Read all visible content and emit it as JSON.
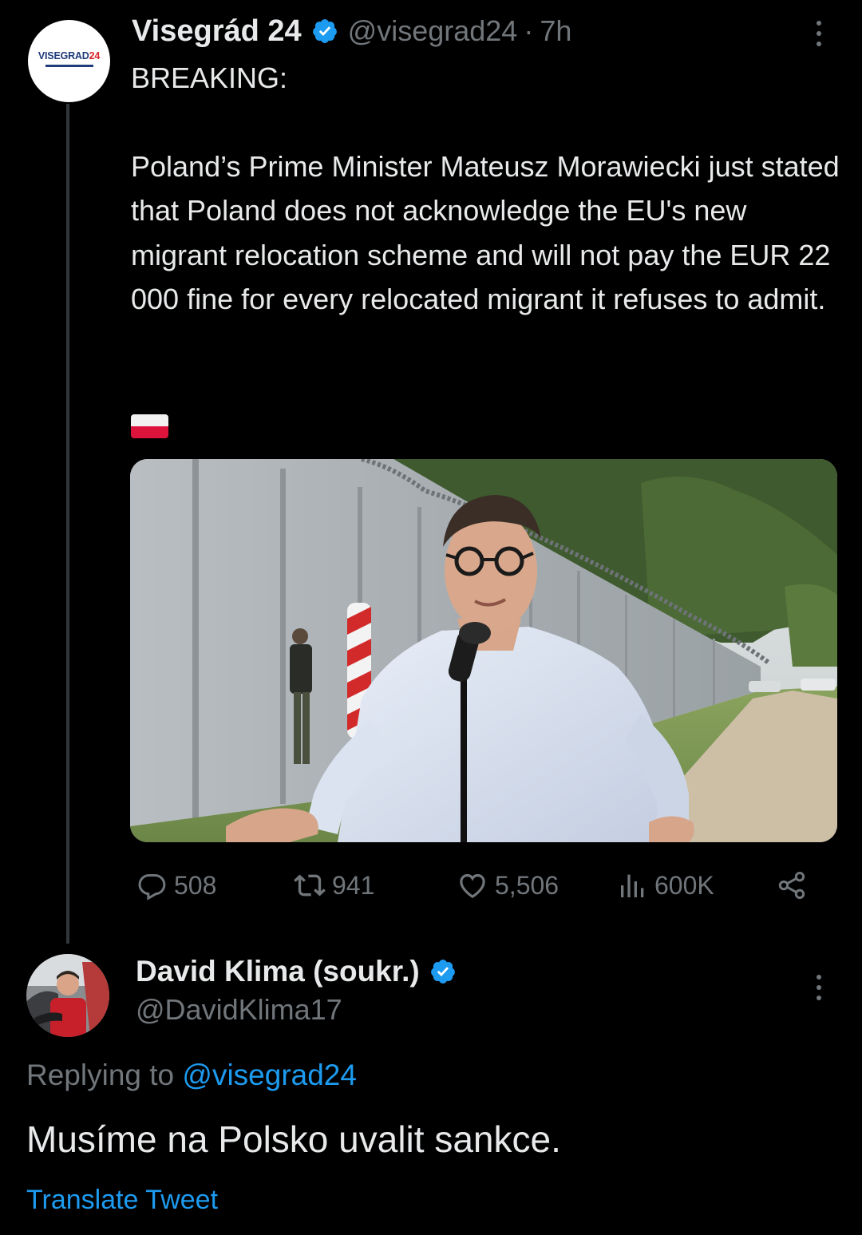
{
  "tweet": {
    "author": {
      "display_name": "Visegrád 24",
      "handle": "@visegrad24",
      "time_ago": "7h",
      "verified": true,
      "avatar_logo_main": "VISEGRAD",
      "avatar_logo_accent": "24"
    },
    "text_headline": "BREAKING:",
    "text_body": "Poland’s Prime Minister Mateusz Morawiecki just stated that Poland does not acknowledge the EU's new migrant relocation scheme and will not pay the EUR 22 000 fine for every relocated migrant it refuses to admit.",
    "flag_emoji_icon": "poland-flag-icon",
    "media_icon": "photo-of-speaker-at-border-fence",
    "actions": {
      "replies": "508",
      "retweets": "941",
      "likes": "5,506",
      "views": "600K"
    }
  },
  "reply": {
    "author": {
      "display_name": "David Klima (soukr.)",
      "handle": "@DavidKlima17",
      "verified": true
    },
    "replying_to_label": "Replying to",
    "replying_to_handle": "@visegrad24",
    "text": "Musíme na Polsko uvalit sankce.",
    "translate_label": "Translate Tweet"
  },
  "colors": {
    "background": "#000000",
    "text_primary": "#e7e9ea",
    "text_secondary": "#71767b",
    "accent_blue": "#1d9bf0",
    "thread_line": "#333639"
  }
}
